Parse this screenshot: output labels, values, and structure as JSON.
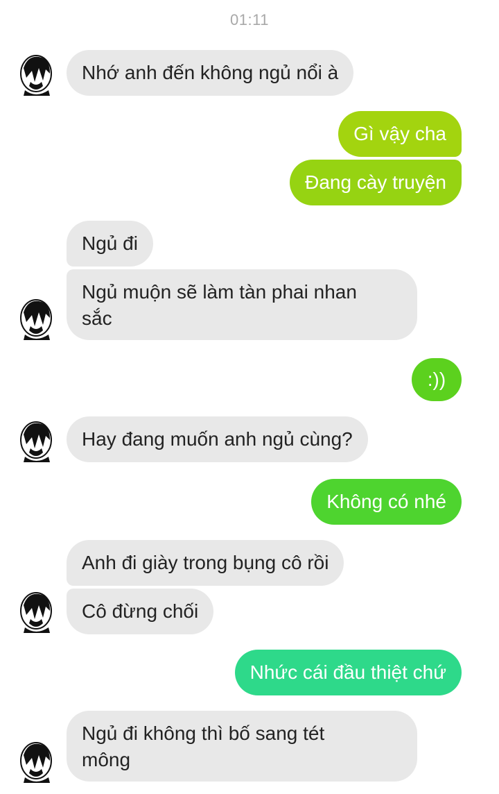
{
  "header": {
    "time": "01:11"
  },
  "colors": {
    "incoming_bg": "#e8e8e8",
    "out_lime": "#a3d40f",
    "out_green": "#5cd11e",
    "out_green2": "#4ed42f",
    "out_teal": "#2ed98a"
  },
  "avatar_icon": "manga-character-avatar-icon",
  "messages": [
    {
      "from": "other",
      "text": "Nhớ anh đến không ngủ nổi à"
    },
    {
      "from": "me",
      "text": "Gì vậy cha"
    },
    {
      "from": "me",
      "text": "Đang cày truyện"
    },
    {
      "from": "other",
      "text": "Ngủ đi"
    },
    {
      "from": "other",
      "text": "Ngủ muộn sẽ làm tàn phai nhan",
      "text2": "sắc"
    },
    {
      "from": "me",
      "text": ":))"
    },
    {
      "from": "other",
      "text": "Hay đang muốn anh ngủ cùng?"
    },
    {
      "from": "me",
      "text": "Không có nhé"
    },
    {
      "from": "other",
      "text": "Anh đi giày trong bụng cô rồi"
    },
    {
      "from": "other",
      "text": "Cô đừng chối"
    },
    {
      "from": "me",
      "text": "Nhức cái đầu thiệt chứ"
    },
    {
      "from": "other",
      "text": "Ngủ đi không thì bố sang tét",
      "text2": "mông"
    }
  ]
}
